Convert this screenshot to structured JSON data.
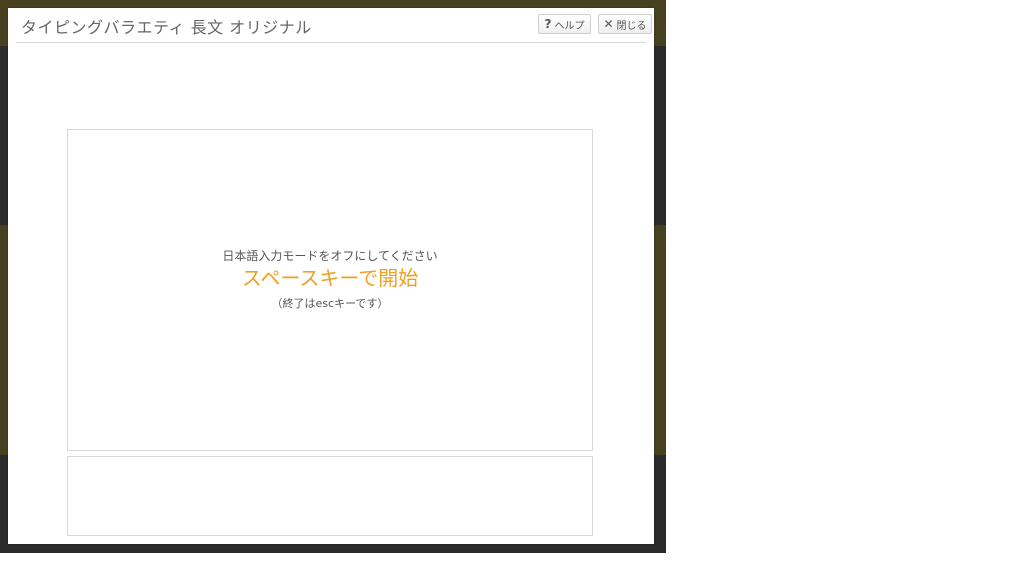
{
  "modal": {
    "title": "タイピングバラエティ 長文 オリジナル",
    "help_label": "ヘルプ",
    "help_icon": "?",
    "close_label": "閉じる",
    "close_icon": "✕"
  },
  "game": {
    "ime_note": "日本語入力モードをオフにしてください",
    "start_prompt": "スペースキーで開始",
    "esc_note": "（終了はescキーです）"
  },
  "colors": {
    "accent": "#f0a020",
    "overlay": "#3a3a3a",
    "background_highlight": "#7a6a12"
  }
}
